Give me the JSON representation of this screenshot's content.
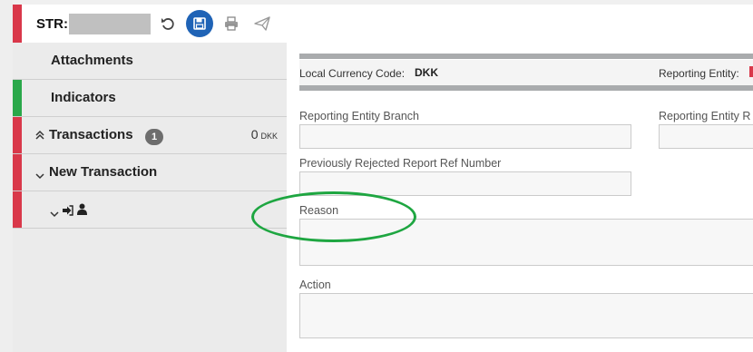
{
  "header": {
    "report_type": "STR:",
    "icons": [
      "undo-icon",
      "save-icon",
      "print-icon",
      "send-icon"
    ]
  },
  "sidebar": {
    "items": [
      {
        "label": "Attachments",
        "marker_color": "#d9384a"
      },
      {
        "label": "Indicators",
        "marker_color": "#2aa84a"
      },
      {
        "label": "Transactions",
        "badge": "1",
        "amount": "0",
        "currency": "DKK",
        "marker_color": "#d9384a"
      },
      {
        "label": "New Transaction",
        "marker_color": "#d9384a"
      },
      {
        "icons": [
          "sign-in-icon",
          "user-icon"
        ],
        "marker_color": "#d9384a"
      }
    ]
  },
  "main": {
    "local_currency_label": "Local Currency Code:",
    "local_currency_value": "DKK",
    "reporting_entity_label": "Reporting Entity:",
    "fields": {
      "branch_label": "Reporting Entity Branch",
      "right_label": "Reporting Entity R",
      "rejected_label": "Previously Rejected Report Ref Number",
      "reason_label": "Reason",
      "action_label": "Action"
    }
  },
  "annotation": {
    "color": "#1ea641"
  }
}
